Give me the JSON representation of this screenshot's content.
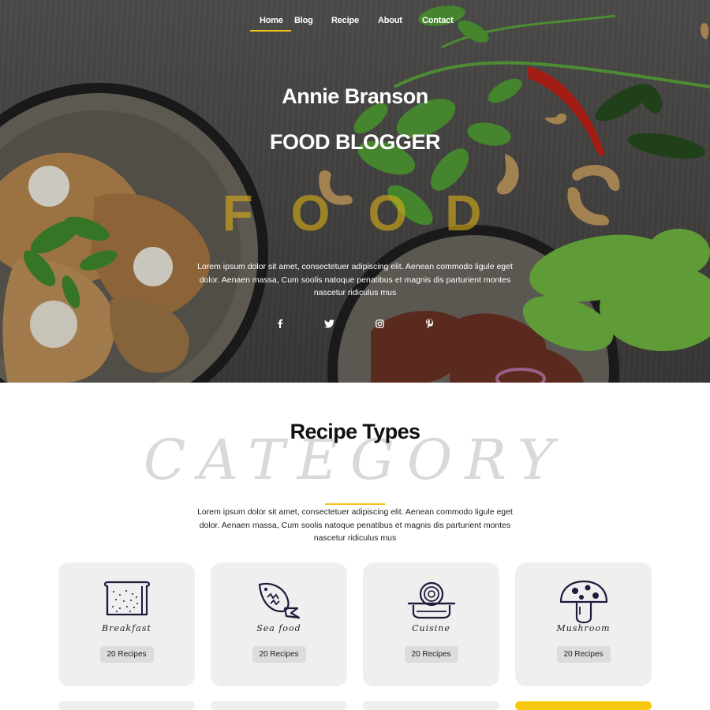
{
  "nav": {
    "items": [
      {
        "label": "Home",
        "active": true
      },
      {
        "label": "Blog",
        "active": false
      },
      {
        "label": "Recipe",
        "active": false
      },
      {
        "label": "About",
        "active": false
      },
      {
        "label": "Contact",
        "active": false
      }
    ]
  },
  "hero": {
    "name": "Annie Branson",
    "role": "FOOD BLOGGER",
    "background_word": "FOOD",
    "text": "Lorem ipsum dolor sit amet, consectetuer adipiscing elit. Aenean commodo ligule eget dolor. Aenaen massa, Cum soolis natoque penatibus et magnis dis parturient montes nascetur ridiculus mus",
    "social_icons": [
      "facebook-icon",
      "twitter-icon",
      "instagram-icon",
      "pinterest-icon"
    ]
  },
  "categories": {
    "title": "Recipe Types",
    "background_word": "CATEGORY",
    "text": "Lorem ipsum dolor sit amet, consectetuer adipiscing elit. Aenean commodo ligule eget dolor. Aenaen massa, Cum soolis natoque penatibus et magnis dis parturient montes nascetur ridiculus mus",
    "cards": [
      {
        "name": "Breakfast",
        "count": "20 Recipes",
        "icon": "bread-icon"
      },
      {
        "name": "Sea food",
        "count": "20 Recipes",
        "icon": "fish-icon"
      },
      {
        "name": "Cuisine",
        "count": "20 Recipes",
        "icon": "noodle-bowl-icon"
      },
      {
        "name": "Mushroom",
        "count": "20 Recipes",
        "icon": "mushroom-icon"
      }
    ]
  },
  "colors": {
    "accent": "#f2c318",
    "card_bg": "#efefef",
    "highlight_card": "#f7c90e"
  }
}
